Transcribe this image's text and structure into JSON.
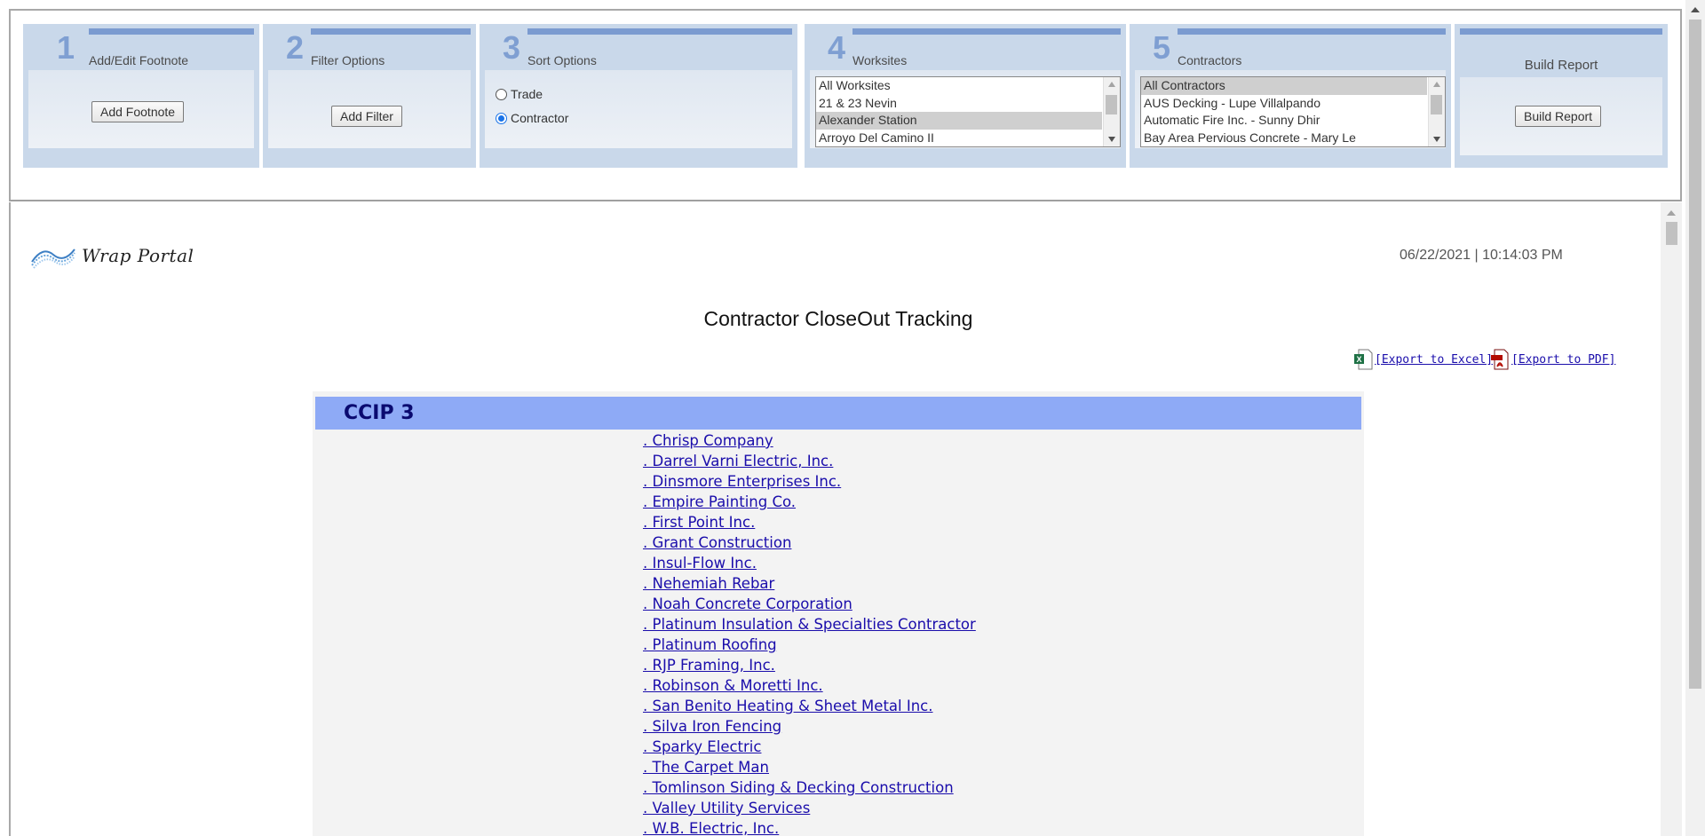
{
  "toolbar": {
    "steps": [
      {
        "number": "1",
        "title": "Add/Edit Footnote",
        "button": "Add Footnote"
      },
      {
        "number": "2",
        "title": "Filter Options",
        "button": "Add Filter"
      },
      {
        "number": "3",
        "title": "Sort Options",
        "options": [
          {
            "label": "Trade",
            "checked": false
          },
          {
            "label": "Contractor",
            "checked": true
          }
        ]
      },
      {
        "number": "4",
        "title": "Worksites",
        "items": [
          "All Worksites",
          "21 & 23 Nevin",
          "Alexander Station",
          "Arroyo Del Camino II"
        ],
        "selected": "Alexander Station"
      },
      {
        "number": "5",
        "title": "Contractors",
        "items": [
          "All Contractors",
          "AUS Decking - Lupe Villalpando",
          "Automatic Fire Inc. - Sunny Dhir",
          "Bay Area Pervious Concrete - Mary Le"
        ],
        "selected": "All Contractors"
      }
    ],
    "build": {
      "title": "Build Report",
      "button": "Build Report"
    }
  },
  "report": {
    "logo_text": "Wrap Portal",
    "timestamp": "06/22/2021 | 10:14:03 PM",
    "title": "Contractor CloseOut Tracking",
    "export_excel": "[Export to Excel]",
    "export_pdf": "[Export to PDF]",
    "group": "CCIP 3",
    "contractors": [
      ". Chrisp Company",
      ". Darrel Varni Electric, Inc.",
      ". Dinsmore Enterprises Inc.",
      ". Empire Painting Co.",
      ". First Point Inc.",
      ". Grant Construction",
      ". Insul-Flow Inc.",
      ". Nehemiah Rebar",
      ". Noah Concrete Corporation",
      ". Platinum Insulation & Specialties Contractor",
      ". Platinum Roofing",
      ". RJP Framing, Inc.",
      ". Robinson & Moretti Inc.",
      ". San Benito Heating & Sheet Metal Inc.",
      ". Silva Iron Fencing",
      ". Sparky Electric",
      ". The Carpet Man",
      ". Tomlinson Siding & Decking Construction",
      ". Valley Utility Services",
      ". W.B. Electric, Inc."
    ]
  }
}
